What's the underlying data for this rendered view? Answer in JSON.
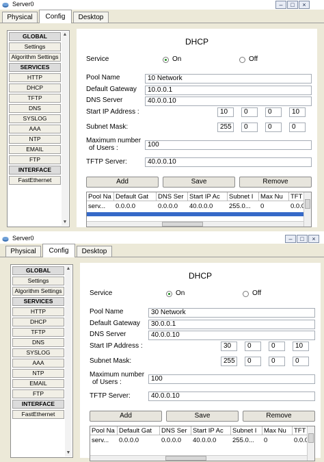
{
  "icons": {
    "app": "router-icon",
    "minimize": "minimize-icon",
    "maximize": "maximize-icon",
    "close": "close-icon"
  },
  "tabs": [
    "Physical",
    "Config",
    "Desktop"
  ],
  "sidebar": {
    "items": [
      "GLOBAL",
      "Settings",
      "Algorithm Settings",
      "SERVICES",
      "HTTP",
      "DHCP",
      "TFTP",
      "DNS",
      "SYSLOG",
      "AAA",
      "NTP",
      "EMAIL",
      "FTP",
      "INTERFACE",
      "FastEthernet"
    ]
  },
  "dhcp": {
    "heading": "DHCP",
    "service_label": "Service",
    "on_label": "On",
    "off_label": "Off",
    "pool_name_label": "Pool Name",
    "gateway_label": "Default Gateway",
    "dns_label": "DNS Server",
    "start_ip_label": "Start IP Address :",
    "subnet_label": "Subnet Mask:",
    "max_users_label_1": "Maximum number",
    "max_users_label_2": "of Users :",
    "tftp_label": "TFTP Server:",
    "add_label": "Add",
    "save_label": "Save",
    "remove_label": "Remove",
    "columns": [
      "Pool Na",
      "Default Gat",
      "DNS Ser",
      "Start IP Ac",
      "Subnet I",
      "Max Nu",
      "TFT"
    ]
  },
  "windows": [
    {
      "title": "Server0",
      "pool_name": "10 Network",
      "gateway": "10.0.0.1",
      "dns": "40.0.0.10",
      "start_ip": [
        "10",
        "0",
        "0",
        "10"
      ],
      "subnet": [
        "255",
        "0",
        "0",
        "0"
      ],
      "max_users": "100",
      "tftp": "40.0.0.10",
      "rows": [
        [
          "serv...",
          "0.0.0.0",
          "0.0.0.0",
          "40.0.0.0",
          "255.0...",
          "0",
          "0.0.0"
        ]
      ]
    },
    {
      "title": "Server0",
      "pool_name": "30 Network",
      "gateway": "30.0.0.1",
      "dns": "40.0.0.10",
      "start_ip": [
        "30",
        "0",
        "0",
        "10"
      ],
      "subnet": [
        "255",
        "0",
        "0",
        "0"
      ],
      "max_users": "100",
      "tftp": "40.0.0.10",
      "rows": [
        [
          "serv...",
          "0.0.0.0",
          "0.0.0.0",
          "40.0.0.0",
          "255.0...",
          "0",
          "0.0.0"
        ]
      ]
    }
  ]
}
